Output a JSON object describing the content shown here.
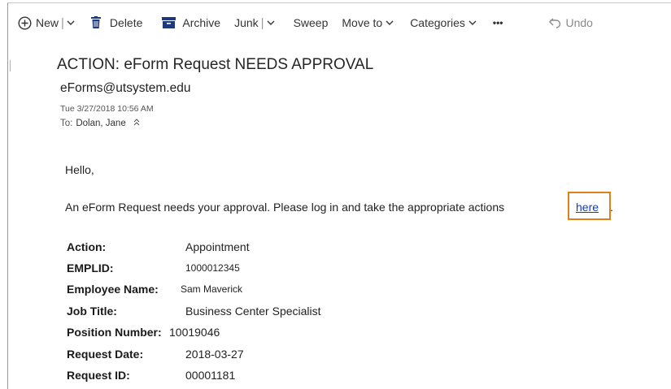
{
  "toolbar": {
    "new_label": "New",
    "delete_label": "Delete",
    "archive_label": "Archive",
    "junk_label": "Junk",
    "sweep_label": "Sweep",
    "move_to_label": "Move to",
    "categories_label": "Categories",
    "more_label": "•••",
    "undo_label": "Undo",
    "separator": "|",
    "icons": [
      "plus-circle-icon",
      "trash-icon",
      "archive-icon",
      "chevron-down-icon",
      "undo-icon"
    ]
  },
  "message": {
    "subject": "ACTION: eForm Request NEEDS APPROVAL",
    "sender": "eForms@utsystem.edu",
    "date": "Tue 3/27/2018 10:56 AM",
    "to_label": "To:",
    "to_name": "Dolan, Jane",
    "greeting": "Hello,",
    "intro_text": "An eForm Request needs your approval. Please log in and take the appropriate actions",
    "link_text": "here",
    "link_suffix": ".",
    "details": [
      {
        "key": "Action:",
        "value": "Appointment"
      },
      {
        "key": "EMPLID:",
        "value": "1000012345"
      },
      {
        "key": "Employee Name:",
        "value": "Sam Maverick"
      },
      {
        "key": "Job Title:",
        "value": "Business Center Specialist"
      },
      {
        "key": "Position Number:",
        "value": "10019046"
      },
      {
        "key": "Request Date:",
        "value": "2018-03-27"
      },
      {
        "key": "Request ID:",
        "value": "00001181"
      }
    ]
  },
  "colors": {
    "link": "#0b3bd6",
    "highlight_box": "#e0801b",
    "toolbar_icon": "#1f3a7a"
  }
}
